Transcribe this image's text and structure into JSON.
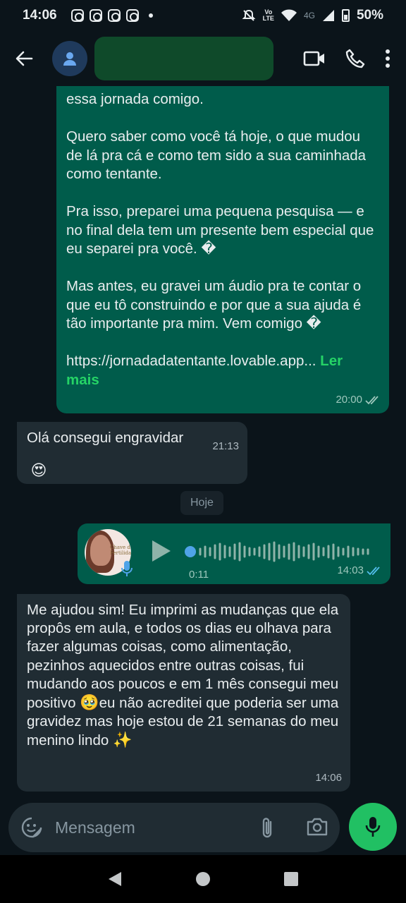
{
  "status_bar": {
    "time": "14:06",
    "network_top": "Vo",
    "network_bottom": "LTE",
    "network_type": "4G",
    "battery": "50%"
  },
  "header": {
    "contact_name": "",
    "icons": [
      "back-arrow-icon",
      "avatar-icon",
      "video-call-icon",
      "phone-icon",
      "more-icon"
    ]
  },
  "messages": {
    "msg1": {
      "p1": "essa jornada comigo.",
      "p2": "Quero saber como você tá hoje, o que mudou de lá pra cá e como tem sido a sua caminhada como tentante.",
      "p3": "Pra isso, preparei uma pequena pesquisa — e no final dela tem um presente bem especial que eu separei pra você. �",
      "p4": "Mas antes, eu gravei um áudio pra te contar o que eu tô construindo e por que a sua ajuda é tão importante pra mim. Vem comigo �",
      "link": "https://jornadadatentante.lovable.app...",
      "read_more": "Ler mais",
      "time": "20:00"
    },
    "msg2": {
      "text": "Olá consegui engravidar",
      "emoji": "😍",
      "time": "21:13"
    },
    "date_chip": "Hoje",
    "voice": {
      "duration": "0:11",
      "time": "14:03",
      "avatar_brand_line1": "Chave da",
      "avatar_brand_line2": "Fertilidade"
    },
    "msg4": {
      "text_a": "Me ajudou sim! Eu imprimi as mudanças que ela propôs em aula, e todos os dias eu olhava para fazer algumas coisas, como alimentação, pezinhos aquecidos entre outras coisas, fui mudando aos poucos e em 1 mês consegui meu positivo ",
      "emoji_a": "🥹",
      "text_b": "eu não acreditei que poderia ser uma gravidez mas hoje estou de 21 semanas do meu menino lindo ",
      "emoji_b": "✨",
      "time": "14:06"
    }
  },
  "composer": {
    "placeholder": "Mensagem"
  },
  "colors": {
    "background": "#0b141a",
    "outgoing_bubble": "#005c4b",
    "incoming_bubble": "#202c33",
    "accent_green": "#25d366",
    "mic_button": "#21c063"
  }
}
